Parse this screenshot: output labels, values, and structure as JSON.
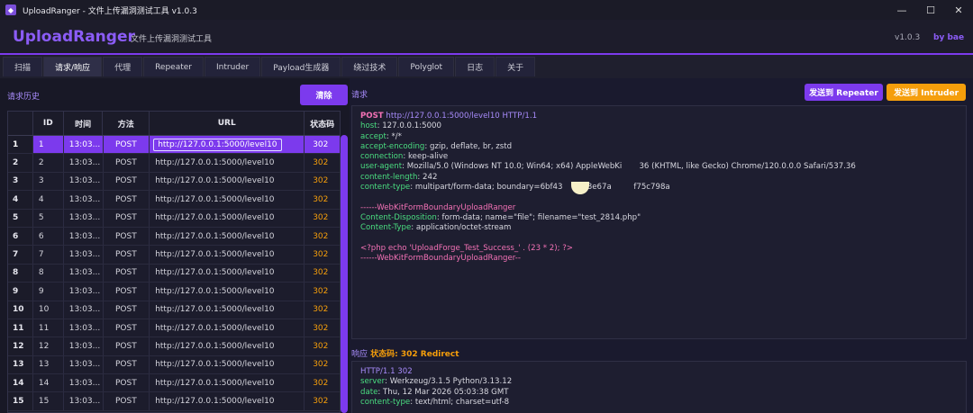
{
  "window": {
    "title": "UploadRanger - 文件上传漏洞测试工具 v1.0.3",
    "controls": [
      "—",
      "☐",
      "✕"
    ]
  },
  "header": {
    "brand": "UploadRanger",
    "subtitle": "文件上传漏洞测试工具",
    "version": "v1.0.3",
    "author": "by bae"
  },
  "tabs": [
    "扫描",
    "请求/响应",
    "代理",
    "Repeater",
    "Intruder",
    "Payload生成器",
    "绕过技术",
    "Polyglot",
    "日志",
    "关于"
  ],
  "active_tab": "请求/响应",
  "history": {
    "title": "请求历史",
    "clear_label": "清除",
    "columns": [
      "",
      "ID",
      "时间",
      "方法",
      "URL",
      "状态码"
    ],
    "rows": [
      {
        "idx": "1",
        "id": "1",
        "time": "13:03...",
        "method": "POST",
        "url": "http://127.0.0.1:5000/level10",
        "status": "302"
      },
      {
        "idx": "2",
        "id": "2",
        "time": "13:03...",
        "method": "POST",
        "url": "http://127.0.0.1:5000/level10",
        "status": "302"
      },
      {
        "idx": "3",
        "id": "3",
        "time": "13:03...",
        "method": "POST",
        "url": "http://127.0.0.1:5000/level10",
        "status": "302"
      },
      {
        "idx": "4",
        "id": "4",
        "time": "13:03...",
        "method": "POST",
        "url": "http://127.0.0.1:5000/level10",
        "status": "302"
      },
      {
        "idx": "5",
        "id": "5",
        "time": "13:03...",
        "method": "POST",
        "url": "http://127.0.0.1:5000/level10",
        "status": "302"
      },
      {
        "idx": "6",
        "id": "6",
        "time": "13:03...",
        "method": "POST",
        "url": "http://127.0.0.1:5000/level10",
        "status": "302"
      },
      {
        "idx": "7",
        "id": "7",
        "time": "13:03...",
        "method": "POST",
        "url": "http://127.0.0.1:5000/level10",
        "status": "302"
      },
      {
        "idx": "8",
        "id": "8",
        "time": "13:03...",
        "method": "POST",
        "url": "http://127.0.0.1:5000/level10",
        "status": "302"
      },
      {
        "idx": "9",
        "id": "9",
        "time": "13:03...",
        "method": "POST",
        "url": "http://127.0.0.1:5000/level10",
        "status": "302"
      },
      {
        "idx": "10",
        "id": "10",
        "time": "13:03...",
        "method": "POST",
        "url": "http://127.0.0.1:5000/level10",
        "status": "302"
      },
      {
        "idx": "11",
        "id": "11",
        "time": "13:03...",
        "method": "POST",
        "url": "http://127.0.0.1:5000/level10",
        "status": "302"
      },
      {
        "idx": "12",
        "id": "12",
        "time": "13:03...",
        "method": "POST",
        "url": "http://127.0.0.1:5000/level10",
        "status": "302"
      },
      {
        "idx": "13",
        "id": "13",
        "time": "13:03...",
        "method": "POST",
        "url": "http://127.0.0.1:5000/level10",
        "status": "302"
      },
      {
        "idx": "14",
        "id": "14",
        "time": "13:03...",
        "method": "POST",
        "url": "http://127.0.0.1:5000/level10",
        "status": "302"
      },
      {
        "idx": "15",
        "id": "15",
        "time": "13:03...",
        "method": "POST",
        "url": "http://127.0.0.1:5000/level10",
        "status": "302"
      }
    ]
  },
  "request": {
    "title": "请求",
    "send_repeater": "发送到 Repeater",
    "send_intruder": "发送到 Intruder",
    "method": "POST",
    "request_line_rest": "http://127.0.0.1:5000/level10 HTTP/1.1",
    "headers": [
      {
        "k": "host",
        "v": "127.0.0.1:5000"
      },
      {
        "k": "accept",
        "v": "*/*"
      },
      {
        "k": "accept-encoding",
        "v": "gzip, deflate, br, zstd"
      },
      {
        "k": "connection",
        "v": "keep-alive"
      },
      {
        "k": "user-agent",
        "v": "Mozilla/5.0 (Windows NT 10.0; Win64; x64) AppleWebKi       36 (KHTML, like Gecko) Chrome/120.0.0.0 Safari/537.36"
      },
      {
        "k": "content-length",
        "v": "242"
      },
      {
        "k": "content-type",
        "v": "multipart/form-data; boundary=6bf43        18e67a         f75c798a"
      }
    ],
    "boundary_line": "------WebKitFormBoundaryUploadRanger",
    "disposition_key": "Content-Disposition",
    "disposition_val": "form-data; name=\"file\"; filename=\"test_2814.php\"",
    "ctype_key": "Content-Type",
    "ctype_val": "application/octet-stream",
    "php_line": "<?php echo 'UploadForge_Test_Success_' . (23 * 2); ?>",
    "boundary_end": "------WebKitFormBoundaryUploadRanger--"
  },
  "response": {
    "title": "响应",
    "status_label": "状态码: 302 Redirect",
    "status_line": "HTTP/1.1 302",
    "headers": [
      {
        "k": "server",
        "v": "Werkzeug/3.1.5 Python/3.13.12"
      },
      {
        "k": "date",
        "v": "Thu, 12 Mar 2026 05:03:38 GMT"
      },
      {
        "k": "content-type",
        "v": "text/html; charset=utf-8"
      }
    ]
  },
  "colors": {
    "accent": "#7c3aed",
    "warning": "#f59e0b",
    "background": "#1a1a2e"
  }
}
